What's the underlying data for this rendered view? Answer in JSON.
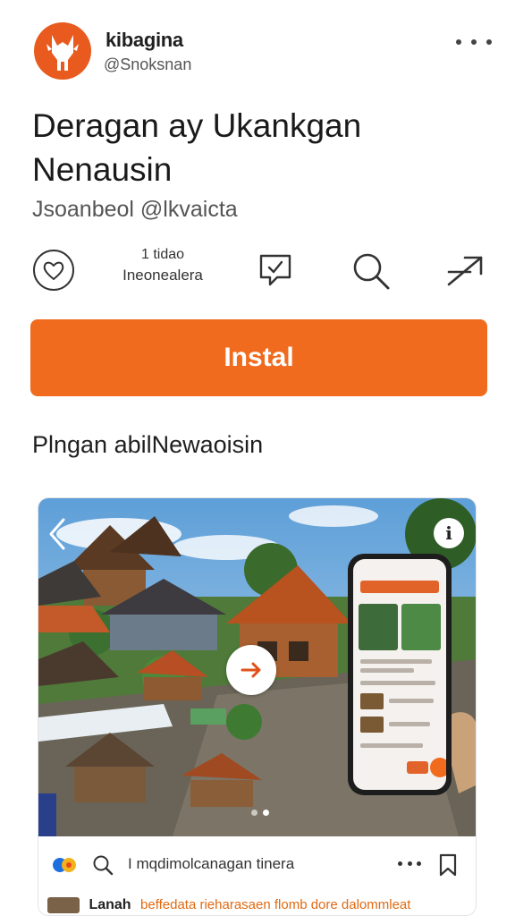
{
  "header": {
    "app_name": "kibagina",
    "handle": "@Snoksnan",
    "avatar_icon": "fox-logo-icon",
    "more_icon": "more-horizontal-icon"
  },
  "title": "Deragan ay Ukankgan Nenausin",
  "subtitle": "Jsoanbeol @lkvaicta",
  "actions": {
    "like_icon": "heart-icon",
    "stats_count": "1 tidao",
    "stats_label": "Ineonealera",
    "comment_icon": "comment-icon",
    "search_icon": "search-icon",
    "share_icon": "share-arrow-icon"
  },
  "install": {
    "label": "Instal"
  },
  "section": {
    "title": "Plngan abilNewaoisin"
  },
  "card": {
    "info_label": "i",
    "carousel": {
      "pages": 2,
      "active": 1
    },
    "footer_text": "I mqdimolcanagan tinera",
    "comment_user": "Lanah",
    "comment_text": "beffedata rieharasaen flomb dore dalommleat"
  },
  "colors": {
    "accent": "#f06b1d",
    "avatar": "#e85a1e",
    "highlight_text": "#e06a12"
  }
}
